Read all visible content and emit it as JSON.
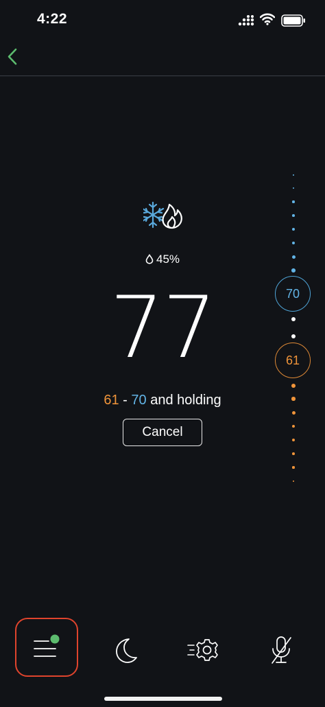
{
  "status_bar": {
    "time": "4:22"
  },
  "nav": {
    "back_icon": "chevron-left-icon",
    "accent_color": "#5cbb6e"
  },
  "mode": {
    "icons": [
      "snowflake-icon",
      "flame-icon"
    ],
    "label": "heat-cool"
  },
  "humidity": {
    "value": "45%",
    "icon": "water-drop-icon"
  },
  "current_temperature": "77",
  "setpoints": {
    "heat": "61",
    "dash": "-",
    "cool": "70",
    "hold_text": "and holding"
  },
  "cancel_button": {
    "label": "Cancel"
  },
  "slider": {
    "cool_setpoint": "70",
    "heat_setpoint": "61",
    "cool_color": "#62b4e6",
    "heat_color": "#f0943a"
  },
  "tab_bar": {
    "items": [
      {
        "name": "menu",
        "icon": "menu-lines-icon",
        "badge": "green-dot",
        "selected": true
      },
      {
        "name": "sleep",
        "icon": "moon-icon",
        "selected": false
      },
      {
        "name": "settings",
        "icon": "fast-gear-icon",
        "selected": false
      },
      {
        "name": "voice",
        "icon": "microphone-muted-icon",
        "selected": false
      }
    ]
  }
}
